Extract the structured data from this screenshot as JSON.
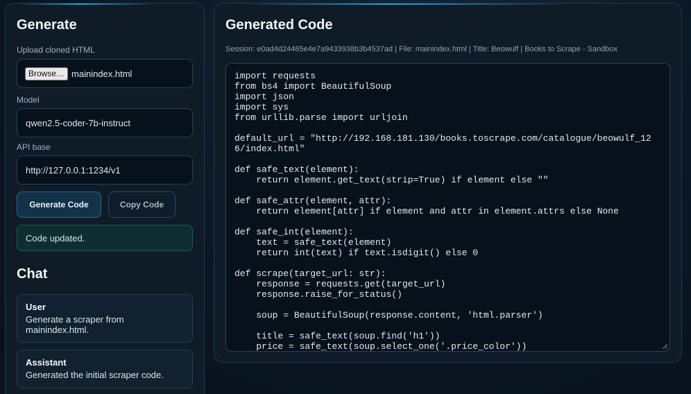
{
  "generate": {
    "title": "Generate",
    "upload_label": "Upload cloned HTML",
    "browse_label": "Browse…",
    "upload_filename": "mainindex.html",
    "model_label": "Model",
    "model_value": "qwen2.5-coder-7b-instruct",
    "api_label": "API base",
    "api_value": "http://127.0.0.1:1234/v1",
    "generate_button": "Generate Code",
    "copy_button": "Copy Code",
    "status": "Code updated."
  },
  "chat": {
    "title": "Chat",
    "messages": [
      {
        "role": "User",
        "text": "Generate a scraper from mainindex.html."
      },
      {
        "role": "Assistant",
        "text": "Generated the initial scraper code."
      }
    ]
  },
  "code_panel": {
    "title": "Generated Code",
    "session_line": "Session: e0ad4d24465e4e7a9433938b3b4537ad | File: mainindex.html | Title: Beowulf | Books to Scrape - Sandbox",
    "code": "import requests\nfrom bs4 import BeautifulSoup\nimport json\nimport sys\nfrom urllib.parse import urljoin\n\ndefault_url = \"http://192.168.181.130/books.toscrape.com/catalogue/beowulf_126/index.html\"\n\ndef safe_text(element):\n    return element.get_text(strip=True) if element else \"\"\n\ndef safe_attr(element, attr):\n    return element[attr] if element and attr in element.attrs else None\n\ndef safe_int(element):\n    text = safe_text(element)\n    return int(text) if text.isdigit() else 0\n\ndef scrape(target_url: str):\n    response = requests.get(target_url)\n    response.raise_for_status()\n\n    soup = BeautifulSoup(response.content, 'html.parser')\n\n    title = safe_text(soup.find('h1'))\n    price = safe_text(soup.select_one('.price_color'))"
  },
  "colors": {
    "accent": "#38bdf8",
    "status_bg": "#0f2e31",
    "panel_bg": "#0f1b27"
  }
}
